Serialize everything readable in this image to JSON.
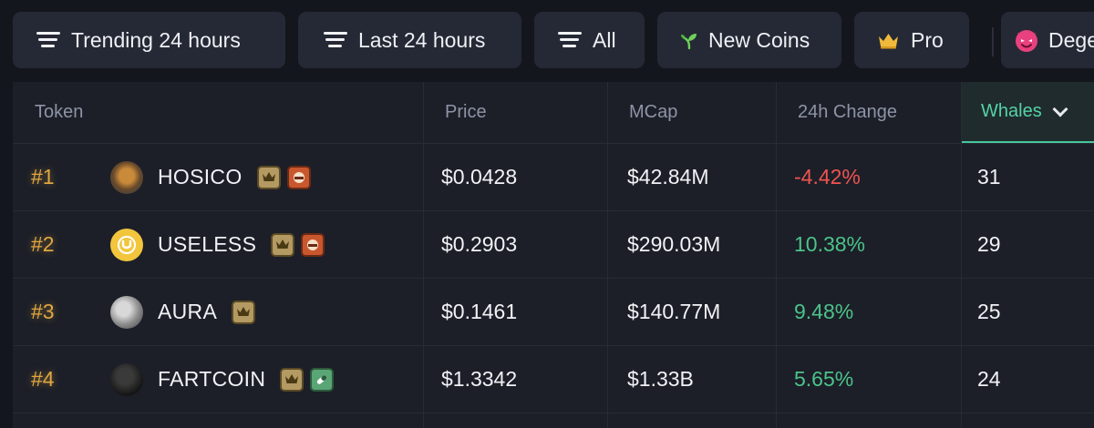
{
  "filters": [
    {
      "label": "Trending 24 hours",
      "icon": "filter-lines-icon"
    },
    {
      "label": "Last 24 hours",
      "icon": "filter-lines-icon"
    },
    {
      "label": "All",
      "icon": "filter-lines-icon"
    },
    {
      "label": "New Coins",
      "icon": "sprout-icon"
    },
    {
      "label": "Pro",
      "icon": "crown-icon"
    },
    {
      "label": "Degen",
      "icon": "devil-icon"
    }
  ],
  "table": {
    "headers": {
      "token": "Token",
      "price": "Price",
      "mcap": "MCap",
      "change": "24h Change",
      "whales": "Whales"
    },
    "sort_column": "Whales",
    "rows": [
      {
        "rank": "#1",
        "name": "HOSICO",
        "price": "$0.0428",
        "mcap": "$42.84M",
        "change": "-4.42%",
        "whales": "31",
        "badges": [
          "crown-badge-icon",
          "pumpfun-badge-icon"
        ],
        "change_color": "#ef5350"
      },
      {
        "rank": "#2",
        "name": "USELESS",
        "price": "$0.2903",
        "mcap": "$290.03M",
        "change": "10.38%",
        "whales": "29",
        "badges": [
          "crown-badge-icon",
          "pumpfun-badge-icon"
        ],
        "change_color": "#4cc38a"
      },
      {
        "rank": "#3",
        "name": "AURA",
        "price": "$0.1461",
        "mcap": "$140.77M",
        "change": "9.48%",
        "whales": "25",
        "badges": [
          "crown-badge-icon"
        ],
        "change_color": "#4cc38a"
      },
      {
        "rank": "#4",
        "name": "FARTCOIN",
        "price": "$1.3342",
        "mcap": "$1.33B",
        "change": "5.65%",
        "whales": "24",
        "badges": [
          "crown-badge-icon",
          "pill-badge-icon"
        ],
        "change_color": "#4cc38a"
      }
    ]
  },
  "colors": {
    "accent_green": "#46c79a",
    "negative": "#ef5350",
    "positive": "#4cc38a",
    "rank_gold": "#e0a640"
  }
}
